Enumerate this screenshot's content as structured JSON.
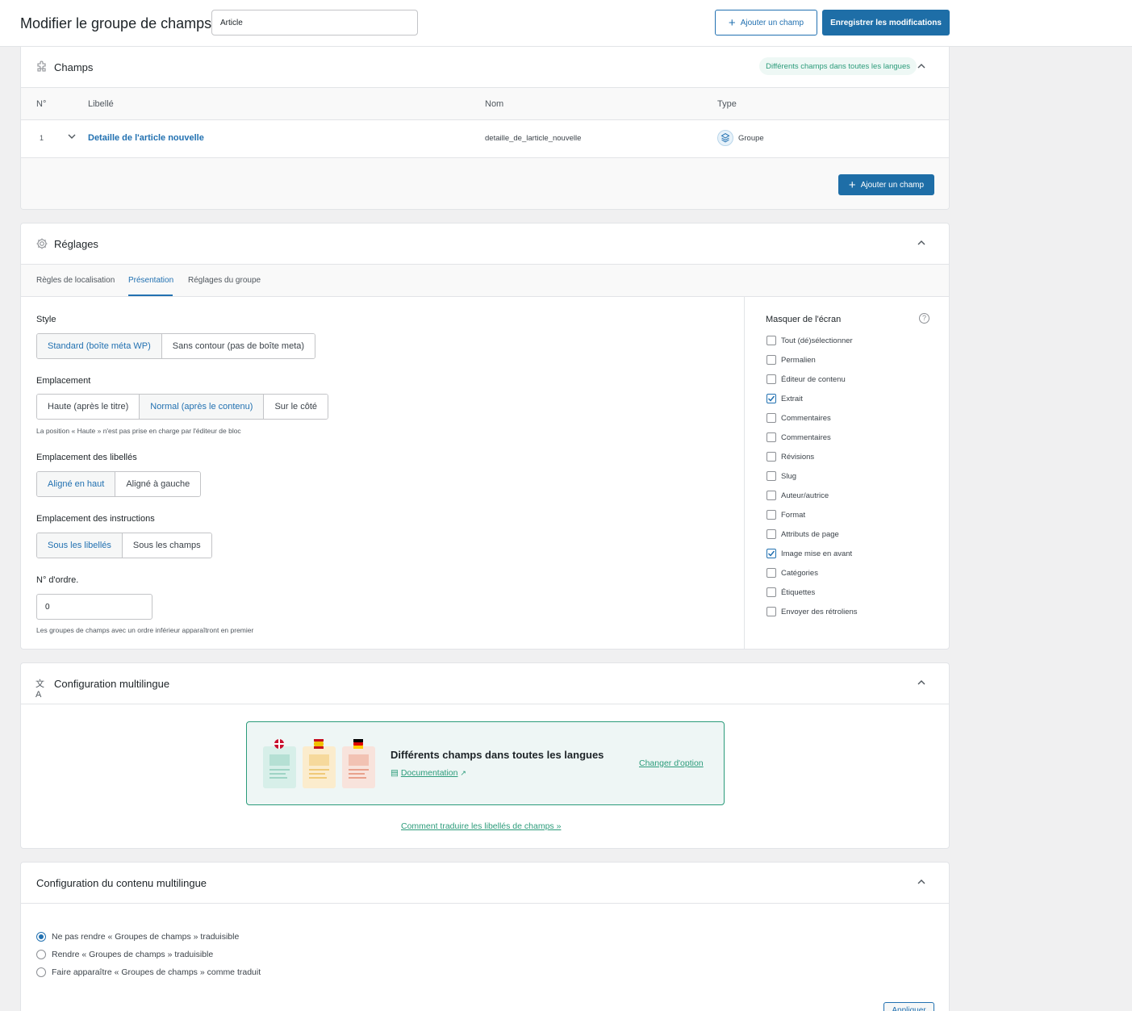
{
  "header": {
    "title": "Modifier le groupe de champs",
    "group_name_value": "Article",
    "add_field_label": "Ajouter un champ",
    "save_label": "Enregistrer les modifications"
  },
  "fields_panel": {
    "title": "Champs",
    "lang_badge": "Différents champs dans toutes les langues",
    "columns": {
      "num": "N°",
      "label": "Libellé",
      "name": "Nom",
      "type": "Type"
    },
    "rows": [
      {
        "num": "1",
        "label": "Detaille de l'article nouvelle",
        "name": "detaille_de_larticle_nouvelle",
        "type": "Groupe"
      }
    ],
    "add_field_label": "Ajouter un champ"
  },
  "settings_panel": {
    "title": "Réglages",
    "tabs": [
      "Règles de localisation",
      "Présentation",
      "Réglages du groupe"
    ],
    "active_tab": "Présentation",
    "style": {
      "label": "Style",
      "options": [
        "Standard (boîte méta WP)",
        "Sans contour (pas de boîte meta)"
      ],
      "selected": "Standard (boîte méta WP)"
    },
    "position": {
      "label": "Emplacement",
      "options": [
        "Haute (après le titre)",
        "Normal (après le contenu)",
        "Sur le côté"
      ],
      "selected": "Normal (après le contenu)",
      "hint": "La position « Haute » n'est pas prise en charge par l'éditeur de bloc"
    },
    "label_placement": {
      "label": "Emplacement des libellés",
      "options": [
        "Aligné en haut",
        "Aligné à gauche"
      ],
      "selected": "Aligné en haut"
    },
    "instruction_placement": {
      "label": "Emplacement des instructions",
      "options": [
        "Sous les libellés",
        "Sous les champs"
      ],
      "selected": "Sous les libellés"
    },
    "order": {
      "label": "N° d'ordre.",
      "value": "0",
      "hint": "Les groupes de champs avec un ordre inférieur apparaîtront en premier"
    },
    "hide_on_screen": {
      "label": "Masquer de l'écran",
      "items": [
        {
          "label": "Tout (dé)sélectionner",
          "checked": false
        },
        {
          "label": "Permalien",
          "checked": false
        },
        {
          "label": "Éditeur de contenu",
          "checked": false
        },
        {
          "label": "Extrait",
          "checked": true
        },
        {
          "label": "Commentaires",
          "checked": false
        },
        {
          "label": "Commentaires",
          "checked": false
        },
        {
          "label": "Révisions",
          "checked": false
        },
        {
          "label": "Slug",
          "checked": false
        },
        {
          "label": "Auteur/autrice",
          "checked": false
        },
        {
          "label": "Format",
          "checked": false
        },
        {
          "label": "Attributs de page",
          "checked": false
        },
        {
          "label": "Image mise en avant",
          "checked": true
        },
        {
          "label": "Catégories",
          "checked": false
        },
        {
          "label": "Étiquettes",
          "checked": false
        },
        {
          "label": "Envoyer des rétroliens",
          "checked": false
        }
      ]
    }
  },
  "multilingual_panel": {
    "title": "Configuration multilingue",
    "card_title": "Différents champs dans toutes les langues",
    "doc_link": "Documentation",
    "change_option": "Changer d'option",
    "translate_link": "Comment traduire les libellés de champs »"
  },
  "content_panel": {
    "title": "Configuration du contenu multilingue",
    "options": [
      {
        "label": "Ne pas rendre « Groupes de champs » traduisible",
        "selected": true
      },
      {
        "label": "Rendre « Groupes de champs » traduisible",
        "selected": false
      },
      {
        "label": "Faire apparaître « Groupes de champs » comme traduit",
        "selected": false
      }
    ],
    "apply_label": "Appliquer"
  }
}
